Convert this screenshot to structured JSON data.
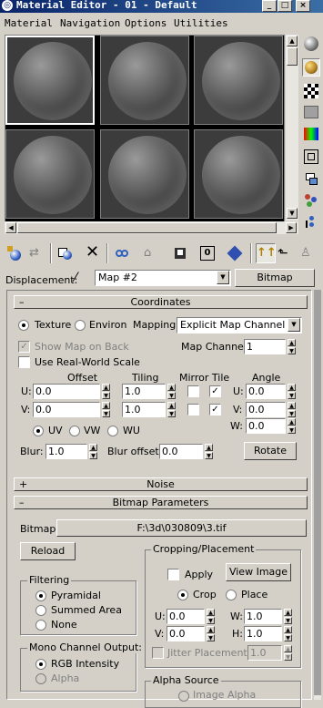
{
  "window": {
    "title": "Material Editor - 01 - Default",
    "minimize_glyph": "_",
    "maximize_glyph": "□",
    "close_glyph": "×"
  },
  "menu": [
    "Material",
    "Navigation",
    "Options",
    "Utilities"
  ],
  "icons": {
    "sample_type": "sphere-icon",
    "backlight": "backlight-icon",
    "background": "checker-background-icon",
    "uv_tiling": "uv-tiling-icon",
    "video_check": "video-color-check-icon",
    "make_preview": "make-preview-icon",
    "options": "options-icon",
    "select_by_material": "select-by-material-icon",
    "map_navigator": "material-map-navigator-icon"
  },
  "params": {
    "displacement_label": "Displacement:",
    "map_name": "Map #2",
    "map_type": "Bitmap"
  },
  "coordinates": {
    "header": "Coordinates",
    "texture_label": "Texture",
    "environ_label": "Environ",
    "mapping_label": "Mapping:",
    "mapping_value": "Explicit Map Channel",
    "show_map_on_back": "Show Map on Back",
    "map_channel_label": "Map Channel:",
    "map_channel_value": "1",
    "use_real_world_scale": "Use Real-World Scale",
    "offset_label": "Offset",
    "tiling_label": "Tiling",
    "mirror_tile_label": "Mirror Tile",
    "angle_label": "Angle",
    "u_label": "U:",
    "v_label": "V:",
    "w_label": "W:",
    "u_offset": "0.0",
    "v_offset": "0.0",
    "u_tiling": "1.0",
    "v_tiling": "1.0",
    "u_angle": "0.0",
    "v_angle": "0.0",
    "w_angle": "0.0",
    "uv_label": "UV",
    "vw_label": "VW",
    "wu_label": "WU",
    "blur_label": "Blur:",
    "blur_value": "1.0",
    "blur_offset_label": "Blur offset:",
    "blur_offset_value": "0.0",
    "rotate_button": "Rotate"
  },
  "noise": {
    "header": "Noise"
  },
  "bitmap_params": {
    "header": "Bitmap Parameters",
    "bitmap_label": "Bitmap:",
    "bitmap_path": "F:\\3d\\030809\\3.tif",
    "reload_button": "Reload",
    "cropping_title": "Cropping/Placement",
    "apply_label": "Apply",
    "view_image_button": "View Image",
    "crop_label": "Crop",
    "place_label": "Place",
    "u_label": "U:",
    "v_label": "V:",
    "w_label": "W:",
    "h_label": "H:",
    "u_value": "0.0",
    "v_value": "0.0",
    "w_value": "1.0",
    "h_value": "1.0",
    "jitter_label": "Jitter Placement:",
    "jitter_value": "1.0",
    "filtering_title": "Filtering",
    "filter_options": [
      "Pyramidal",
      "Summed Area",
      "None"
    ],
    "mono_title": "Mono Channel Output:",
    "mono_options": [
      "RGB Intensity",
      "Alpha"
    ],
    "alpha_source_title": "Alpha Source",
    "alpha_source_first": "Image Alpha"
  }
}
